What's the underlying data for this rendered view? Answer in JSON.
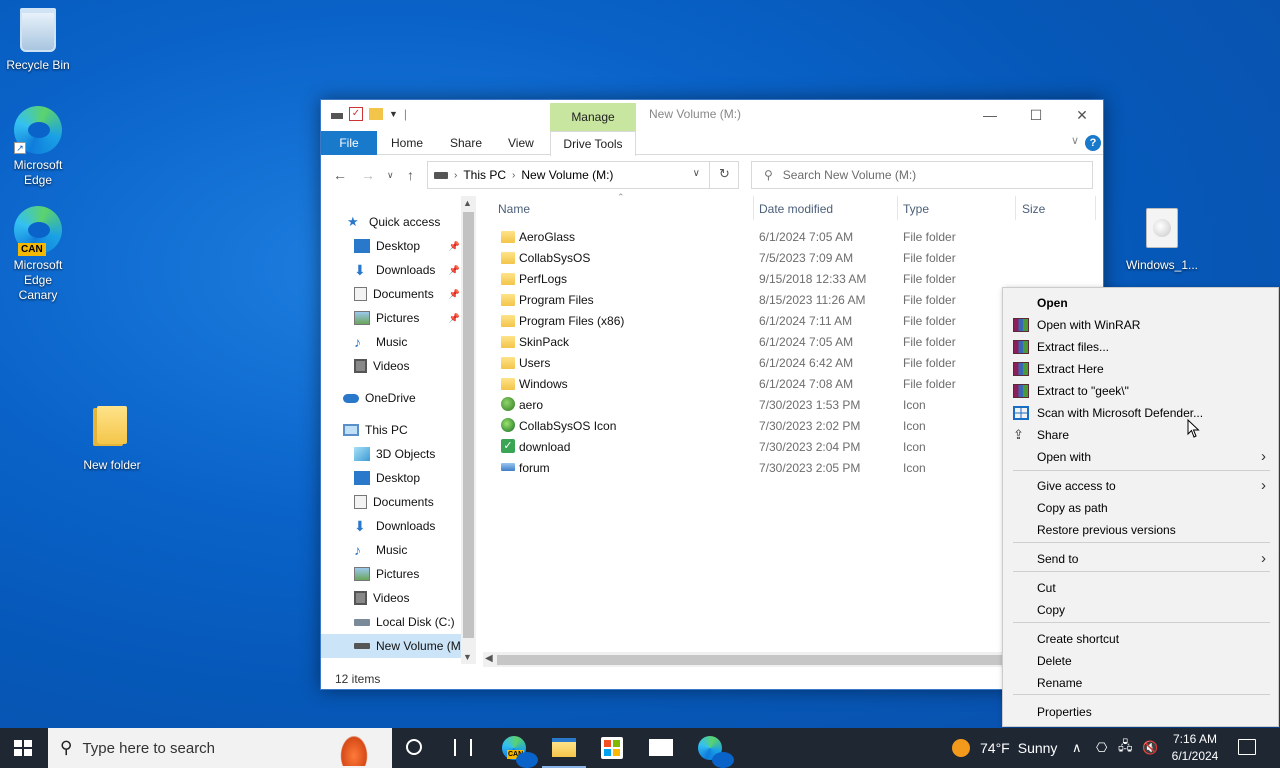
{
  "desktop": {
    "icons": [
      {
        "label": "Recycle Bin"
      },
      {
        "label": "Microsoft Edge"
      },
      {
        "label": "Microsoft Edge Canary",
        "badge": "CAN"
      },
      {
        "label": "New folder"
      },
      {
        "label": "Windows_1..."
      }
    ]
  },
  "explorer": {
    "manage_tab": "Manage",
    "window_title": "New Volume (M:)",
    "ribbon": {
      "file": "File",
      "home": "Home",
      "share": "Share",
      "view": "View",
      "drive_tools": "Drive Tools",
      "help": "?"
    },
    "address": {
      "crumbs": [
        "This PC",
        "New Volume (M:)"
      ]
    },
    "search": {
      "placeholder": "Search New Volume (M:)"
    },
    "nav": {
      "quick_access": "Quick access",
      "quick_items": [
        {
          "label": "Desktop",
          "pinned": true
        },
        {
          "label": "Downloads",
          "pinned": true
        },
        {
          "label": "Documents",
          "pinned": true
        },
        {
          "label": "Pictures",
          "pinned": true
        },
        {
          "label": "Music",
          "pinned": false
        },
        {
          "label": "Videos",
          "pinned": false
        }
      ],
      "onedrive": "OneDrive",
      "this_pc": "This PC",
      "pc_items": [
        "3D Objects",
        "Desktop",
        "Documents",
        "Downloads",
        "Music",
        "Pictures",
        "Videos",
        "Local Disk (C:)",
        "New Volume (M"
      ]
    },
    "columns": {
      "name": "Name",
      "date": "Date modified",
      "type": "Type",
      "size": "Size"
    },
    "files": [
      {
        "name": "AeroGlass",
        "date": "6/1/2024 7:05 AM",
        "type": "File folder",
        "icon": "folder"
      },
      {
        "name": "CollabSysOS",
        "date": "7/5/2023 7:09 AM",
        "type": "File folder",
        "icon": "folder"
      },
      {
        "name": "PerfLogs",
        "date": "9/15/2018 12:33 AM",
        "type": "File folder",
        "icon": "folder"
      },
      {
        "name": "Program Files",
        "date": "8/15/2023 11:26 AM",
        "type": "File folder",
        "icon": "folder"
      },
      {
        "name": "Program Files (x86)",
        "date": "6/1/2024 7:11 AM",
        "type": "File folder",
        "icon": "folder"
      },
      {
        "name": "SkinPack",
        "date": "6/1/2024 7:05 AM",
        "type": "File folder",
        "icon": "folder"
      },
      {
        "name": "Users",
        "date": "6/1/2024 6:42 AM",
        "type": "File folder",
        "icon": "folder"
      },
      {
        "name": "Windows",
        "date": "6/1/2024 7:08 AM",
        "type": "File folder",
        "icon": "folder"
      },
      {
        "name": "aero",
        "date": "7/30/2023 1:53 PM",
        "type": "Icon",
        "icon": "aero"
      },
      {
        "name": "CollabSysOS Icon",
        "date": "7/30/2023 2:02 PM",
        "type": "Icon",
        "icon": "collab"
      },
      {
        "name": "download",
        "date": "7/30/2023 2:04 PM",
        "type": "Icon",
        "icon": "download"
      },
      {
        "name": "forum",
        "date": "7/30/2023 2:05 PM",
        "type": "Icon",
        "icon": "forum"
      }
    ],
    "status": "12 items"
  },
  "context_menu": {
    "items": [
      {
        "label": "Open",
        "bold": true
      },
      {
        "label": "Open with WinRAR",
        "icon": "winrar-icon"
      },
      {
        "label": "Extract files...",
        "icon": "winrar-icon"
      },
      {
        "label": "Extract Here",
        "icon": "winrar-icon"
      },
      {
        "label": "Extract to \"geek\\\"",
        "icon": "winrar-icon"
      },
      {
        "label": "Scan with Microsoft Defender...",
        "icon": "defender-icon"
      },
      {
        "label": "Share",
        "icon": "share-icon"
      },
      {
        "label": "Open with",
        "submenu": true
      },
      {
        "label": "Give access to",
        "submenu": true
      },
      {
        "label": "Copy as path"
      },
      {
        "label": "Restore previous versions"
      },
      {
        "label": "Send to",
        "submenu": true
      },
      {
        "label": "Cut"
      },
      {
        "label": "Copy"
      },
      {
        "label": "Create shortcut"
      },
      {
        "label": "Delete"
      },
      {
        "label": "Rename"
      },
      {
        "label": "Properties"
      }
    ]
  },
  "taskbar": {
    "search_placeholder": "Type here to search",
    "weather": {
      "temp": "74°F",
      "condition": "Sunny"
    },
    "time": "7:16 AM",
    "date": "6/1/2024",
    "edge_canary_badge": "CAN"
  }
}
